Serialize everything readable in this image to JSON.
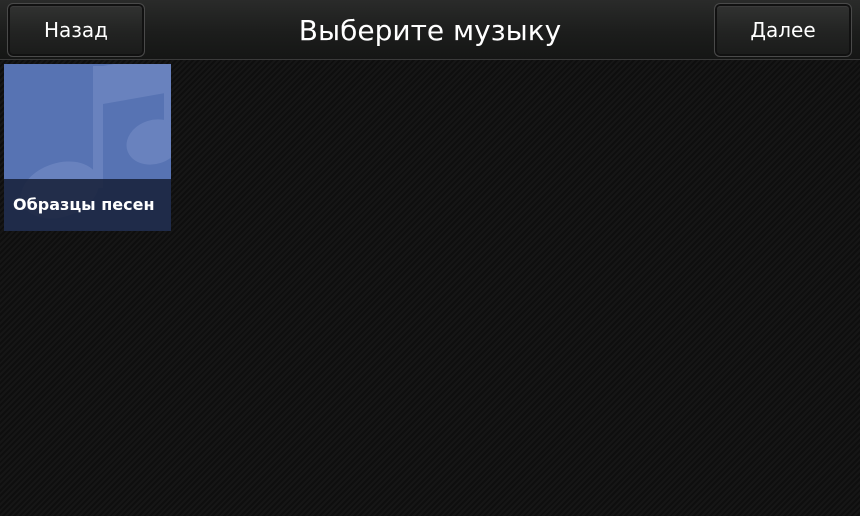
{
  "header": {
    "title": "Выберите музыку",
    "back_label": "Назад",
    "next_label": "Далее"
  },
  "content": {
    "items": [
      {
        "label": "Образцы песен",
        "icon": "music-note-icon",
        "color": "#5773b3"
      }
    ]
  }
}
